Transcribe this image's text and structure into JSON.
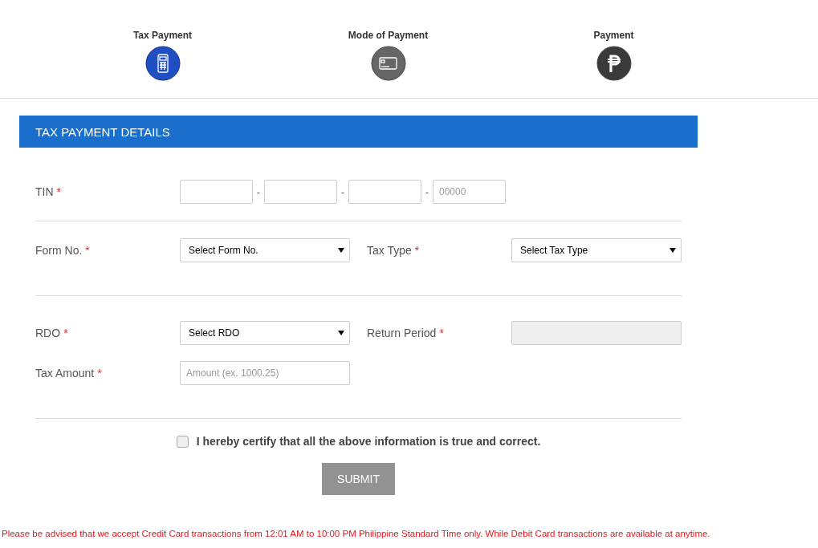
{
  "steps": [
    {
      "label": "Tax Payment",
      "kind": "terminal",
      "selected": true
    },
    {
      "label": "Mode of Payment",
      "kind": "card",
      "selected": false
    },
    {
      "label": "Payment",
      "kind": "peso",
      "selected": false
    }
  ],
  "panel_title": "TAX PAYMENT DETAILS",
  "tin": {
    "label": "TIN",
    "required_mark": "*",
    "parts": [
      {
        "kind": "text"
      },
      {
        "kind": "text"
      },
      {
        "kind": "text"
      },
      {
        "kind": "text",
        "placeholder": "00000"
      }
    ],
    "separator": "-"
  },
  "rows": [
    [
      {
        "label": "Form No.",
        "required_mark": "*",
        "kind": "select",
        "value": "Select Form No.",
        "disabled": false
      },
      {
        "label": "Tax Type",
        "required_mark": "*",
        "kind": "select",
        "value": "Select Tax Type",
        "disabled": false
      }
    ],
    [
      {
        "label": "RDO",
        "required_mark": "*",
        "kind": "select",
        "value": "Select RDO",
        "disabled": false
      },
      {
        "label": "Return Period",
        "required_mark": "*",
        "kind": "input",
        "disabled": true
      }
    ],
    [
      {
        "label": "Tax Amount",
        "required_mark": "*",
        "kind": "input",
        "placeholder": "Amount (ex. 1000.25)",
        "disabled": false
      }
    ]
  ],
  "certify": {
    "label": "I hereby certify that all the above information is true and correct.",
    "checked": false
  },
  "submit": "SUBMIT",
  "notice": "Please be advised that we accept Credit Card transactions from 12:01 AM to 10:00 PM Philippine Standard Time only. While Debit Card transactions are available at anytime."
}
